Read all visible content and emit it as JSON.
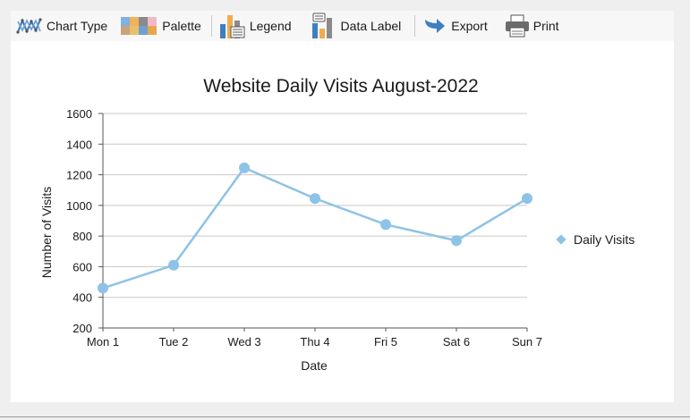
{
  "toolbar": {
    "chart_type": "Chart Type",
    "palette": "Palette",
    "legend": "Legend",
    "data_label": "Data Label",
    "export": "Export",
    "print": "Print"
  },
  "chart_data": {
    "type": "line",
    "title": "Website Daily Visits August-2022",
    "xlabel": "Date",
    "ylabel": "Number of Visits",
    "categories": [
      "Mon 1",
      "Tue 2",
      "Wed 3",
      "Thu 4",
      "Fri 5",
      "Sat 6",
      "Sun 7"
    ],
    "series": [
      {
        "name": "Daily Visits",
        "values": [
          460,
          610,
          1245,
          1045,
          875,
          770,
          1045
        ],
        "color": "#8dc3e6"
      }
    ],
    "ylim": [
      200,
      1600
    ],
    "yticks": [
      200,
      400,
      600,
      800,
      1000,
      1200,
      1400,
      1600
    ],
    "grid": true,
    "legend": "right"
  }
}
